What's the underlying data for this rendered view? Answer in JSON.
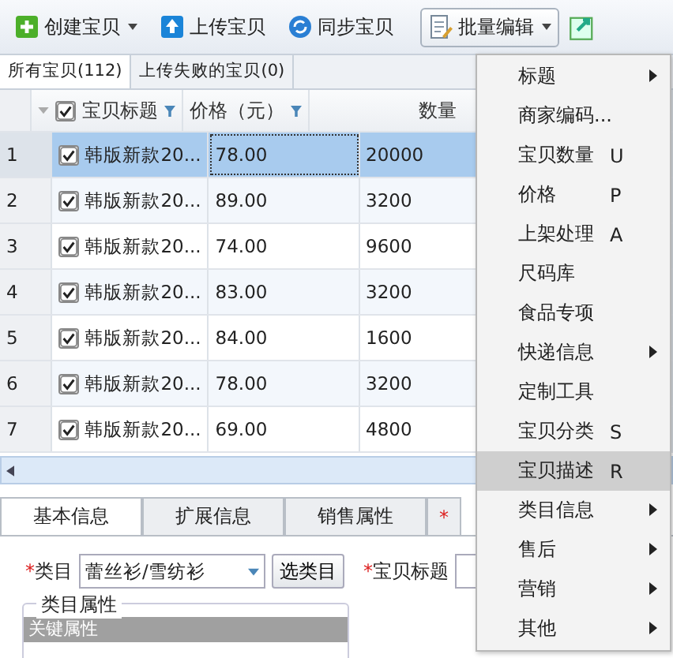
{
  "toolbar": [
    {
      "kind": "create",
      "label": "创建宝贝",
      "dropdown": true
    },
    {
      "kind": "upload",
      "label": "上传宝贝",
      "dropdown": false
    },
    {
      "kind": "sync",
      "label": "同步宝贝",
      "dropdown": false
    },
    {
      "kind": "batch",
      "label": "批量编辑",
      "dropdown": true
    }
  ],
  "tabs": [
    {
      "label": "所有宝贝(112)",
      "selected": true
    },
    {
      "label": "上传失败的宝贝(0)",
      "selected": false
    }
  ],
  "table": {
    "select_all_checked": true,
    "columns": [
      "宝贝标题",
      "价格（元）",
      "数量"
    ],
    "rows": [
      {
        "num": "1",
        "checked": true,
        "selected": true,
        "title": "韩版新款20...",
        "price": "78.00",
        "quantity": "20000"
      },
      {
        "num": "2",
        "checked": true,
        "selected": false,
        "title": "韩版新款20...",
        "price": "89.00",
        "quantity": "3200"
      },
      {
        "num": "3",
        "checked": true,
        "selected": false,
        "title": "韩版新款20...",
        "price": "74.00",
        "quantity": "9600"
      },
      {
        "num": "4",
        "checked": true,
        "selected": false,
        "title": "韩版新款20...",
        "price": "83.00",
        "quantity": "3200"
      },
      {
        "num": "5",
        "checked": true,
        "selected": false,
        "title": "韩版新款20...",
        "price": "84.00",
        "quantity": "1600"
      },
      {
        "num": "6",
        "checked": true,
        "selected": false,
        "title": "韩版新款20...",
        "price": "78.00",
        "quantity": "3200"
      },
      {
        "num": "7",
        "checked": true,
        "selected": false,
        "title": "韩版新款20...",
        "price": "69.00",
        "quantity": "4800"
      }
    ]
  },
  "bottom_tabs": [
    {
      "label": "基本信息",
      "selected": true
    },
    {
      "label": "扩展信息",
      "selected": false
    },
    {
      "label": "销售属性",
      "selected": false
    },
    {
      "label": "*",
      "selected": false
    }
  ],
  "form": {
    "category_label": "类目",
    "category_value": "蕾丝衫/雪纺衫",
    "choose_button": "选类目",
    "title_label": "宝贝标题",
    "group_legend": "类目属性",
    "group_header": "关键属性"
  },
  "menu": [
    {
      "label": "标题",
      "submenu": true,
      "selected": false
    },
    {
      "label": "商家编码...",
      "submenu": false,
      "selected": false
    },
    {
      "label": "宝贝数量",
      "shortcut": "U",
      "submenu": false,
      "selected": false
    },
    {
      "label": "价格",
      "shortcut": "P",
      "submenu": false,
      "selected": false
    },
    {
      "label": "上架处理",
      "shortcut": "A",
      "submenu": false,
      "selected": false
    },
    {
      "label": "尺码库",
      "submenu": false,
      "selected": false
    },
    {
      "label": "食品专项",
      "submenu": false,
      "selected": false
    },
    {
      "label": "快递信息",
      "submenu": true,
      "selected": false
    },
    {
      "label": "定制工具",
      "submenu": false,
      "selected": false
    },
    {
      "label": "宝贝分类",
      "shortcut": "S",
      "submenu": false,
      "selected": false
    },
    {
      "label": "宝贝描述",
      "shortcut": "R",
      "submenu": false,
      "selected": true
    },
    {
      "label": "类目信息",
      "submenu": true,
      "selected": false
    },
    {
      "label": "售后",
      "submenu": true,
      "selected": false
    },
    {
      "label": "营销",
      "submenu": true,
      "selected": false
    },
    {
      "label": "其他",
      "submenu": true,
      "selected": false
    }
  ]
}
